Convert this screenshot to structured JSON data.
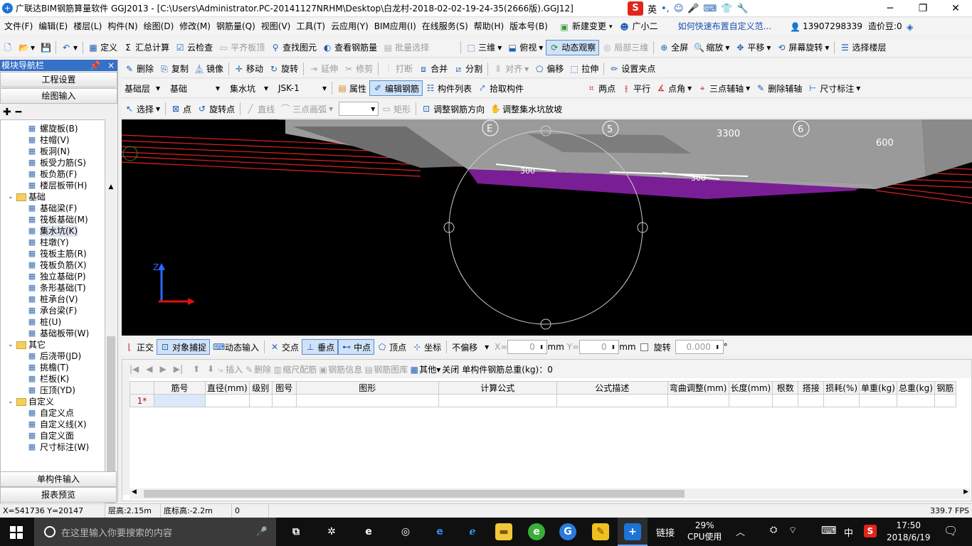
{
  "window": {
    "title": "广联达BIM钢筋算量软件 GGJ2013 - [C:\\Users\\Administrator.PC-20141127NRHM\\Desktop\\白龙村-2018-02-02-19-24-35(2666版).GGJ12]",
    "app_icon": "glodon-icon",
    "min": "─",
    "max": "❐",
    "close": "✕"
  },
  "ime": {
    "label": "英",
    "s": "S"
  },
  "menu": [
    "文件(F)",
    "编辑(E)",
    "楼层(L)",
    "构件(N)",
    "绘图(D)",
    "修改(M)",
    "钢筋量(Q)",
    "视图(V)",
    "工具(T)",
    "云应用(Y)",
    "BIM应用(I)",
    "在线服务(S)",
    "帮助(H)",
    "版本号(B)"
  ],
  "menu_right": {
    "new_change": "新建变更",
    "xiaoer": "广小二",
    "hint": "如何快速布置自定义范...",
    "phone": "13907298339",
    "cost": "造价豆:0"
  },
  "toolbar1": {
    "define": "定义",
    "sum": "汇总计算",
    "cloud_check": "云检查",
    "flat_top": "平齐板顶",
    "find": "查找图元",
    "view_rebar": "查看钢筋量",
    "batch": "批量选择",
    "three_d": "三维",
    "top_view": "俯视",
    "dynamic": "动态观察",
    "local3d": "局部三维",
    "fullscreen": "全屏",
    "zoom": "缩放",
    "pan": "平移",
    "rotate_screen": "屏幕旋转",
    "select_floor": "选择楼层"
  },
  "toolbar2": {
    "delete": "删除",
    "copy": "复制",
    "mirror": "镜像",
    "move": "移动",
    "rotate": "旋转",
    "extend": "延伸",
    "trim": "修剪",
    "break": "打断",
    "merge": "合并",
    "split": "分割",
    "align": "对齐",
    "offset": "偏移",
    "stretch": "拉伸",
    "set_grip": "设置夹点"
  },
  "toolbar3": {
    "layer": "基础层",
    "cat": "基础",
    "type": "集水坑",
    "comp": "JSK-1",
    "props": "属性",
    "edit_rebar": "编辑钢筋",
    "comp_list": "构件列表",
    "pick": "拾取构件",
    "two_pt": "两点",
    "parallel": "平行",
    "pt_angle": "点角",
    "three_pt_axis": "三点辅轴",
    "del_axis": "删除辅轴",
    "dim": "尺寸标注"
  },
  "toolbar4": {
    "select": "选择",
    "point": "点",
    "rotate_point": "旋转点",
    "line": "直线",
    "arc": "三点画弧",
    "rect": "矩形",
    "adjust_dir": "调整钢筋方向",
    "adjust_slope": "调整集水坑放坡"
  },
  "left": {
    "title": "模块导航栏",
    "pin": "ᵖ",
    "close": "×",
    "btn1": "工程设置",
    "btn2": "绘图输入",
    "btn3": "单构件输入",
    "btn4": "报表预览"
  },
  "tree": [
    {
      "label": "螺旋板(B)",
      "indent": 2,
      "icon": "spiral-icon"
    },
    {
      "label": "柱帽(V)",
      "indent": 2,
      "icon": "column-cap-icon"
    },
    {
      "label": "板洞(N)",
      "indent": 2,
      "icon": "slab-hole-icon"
    },
    {
      "label": "板受力筋(S)",
      "indent": 2,
      "icon": "slab-rebar-icon"
    },
    {
      "label": "板负筋(F)",
      "indent": 2,
      "icon": "slab-neg-rebar-icon"
    },
    {
      "label": "楼层板带(H)",
      "indent": 2,
      "icon": "floor-strip-icon"
    },
    {
      "label": "基础",
      "indent": 1,
      "icon": "folder-icon",
      "folder": true
    },
    {
      "label": "基础梁(F)",
      "indent": 2,
      "icon": "found-beam-icon"
    },
    {
      "label": "筏板基础(M)",
      "indent": 2,
      "icon": "raft-icon"
    },
    {
      "label": "集水坑(K)",
      "indent": 2,
      "icon": "sump-icon",
      "selected": true
    },
    {
      "label": "柱墩(Y)",
      "indent": 2,
      "icon": "pier-icon"
    },
    {
      "label": "筏板主筋(R)",
      "indent": 2,
      "icon": "raft-main-icon"
    },
    {
      "label": "筏板负筋(X)",
      "indent": 2,
      "icon": "raft-neg-icon"
    },
    {
      "label": "独立基础(P)",
      "indent": 2,
      "icon": "isolated-found-icon"
    },
    {
      "label": "条形基础(T)",
      "indent": 2,
      "icon": "strip-found-icon"
    },
    {
      "label": "桩承台(V)",
      "indent": 2,
      "icon": "pile-cap-icon"
    },
    {
      "label": "承台梁(F)",
      "indent": 2,
      "icon": "cap-beam-icon"
    },
    {
      "label": "桩(U)",
      "indent": 2,
      "icon": "pile-icon"
    },
    {
      "label": "基础板带(W)",
      "indent": 2,
      "icon": "found-strip-icon"
    },
    {
      "label": "其它",
      "indent": 1,
      "icon": "folder-icon",
      "folder": true
    },
    {
      "label": "后浇带(JD)",
      "indent": 2,
      "icon": "post-cast-icon"
    },
    {
      "label": "挑檐(T)",
      "indent": 2,
      "icon": "eave-icon"
    },
    {
      "label": "栏板(K)",
      "indent": 2,
      "icon": "parapet-icon"
    },
    {
      "label": "压顶(YD)",
      "indent": 2,
      "icon": "coping-icon"
    },
    {
      "label": "自定义",
      "indent": 1,
      "icon": "folder-icon",
      "folder": true
    },
    {
      "label": "自定义点",
      "indent": 2,
      "icon": "custom-point-icon"
    },
    {
      "label": "自定义线(X)",
      "indent": 2,
      "icon": "custom-line-icon"
    },
    {
      "label": "自定义面",
      "indent": 2,
      "icon": "custom-face-icon"
    },
    {
      "label": "尺寸标注(W)",
      "indent": 2,
      "icon": "dimension-icon"
    }
  ],
  "viewport": {
    "labels": [
      "E",
      "5",
      "6",
      "3300",
      "600",
      "300",
      "300"
    ],
    "axis_z": "Z",
    "axis_x": "X"
  },
  "snap": {
    "ortho": "正交",
    "snap": "对象捕捉",
    "dyn": "动态输入",
    "intersect": "交点",
    "perp": "垂点",
    "mid": "中点",
    "vertex": "顶点",
    "coord": "坐标",
    "offset": "不偏移",
    "x_label": "X=",
    "x_val": "0",
    "y_label": "Y=",
    "y_val": "0",
    "unit": "mm",
    "rotate": "旋转",
    "rot_val": "0.000",
    "deg": "°"
  },
  "rebar": {
    "insert": "插入",
    "delete": "删除",
    "scale": "缩尺配筋",
    "info": "钢筋信息",
    "lib": "钢筋图库",
    "other": "其他",
    "close": "关闭",
    "total": "单构件钢筋总重(kg)：0",
    "columns": [
      "筋号",
      "直径(mm)",
      "级别",
      "图号",
      "图形",
      "计算公式",
      "公式描述",
      "弯曲调整(mm)",
      "长度(mm)",
      "根数",
      "搭接",
      "损耗(%)",
      "单重(kg)",
      "总重(kg)",
      "钢筋"
    ],
    "row1": "1*"
  },
  "status": {
    "coords": "X=541736 Y=20147",
    "floor_h": "层高:2.15m",
    "base_h": "底标高:-2.2m",
    "val": "0",
    "fps": "339.7 FPS"
  },
  "taskbar": {
    "search": "在这里输入你要搜索的内容",
    "link": "链接",
    "cpu_pct": "29%",
    "cpu": "CPU使用",
    "lang": "中",
    "time": "17:50",
    "date": "2018/6/19"
  }
}
